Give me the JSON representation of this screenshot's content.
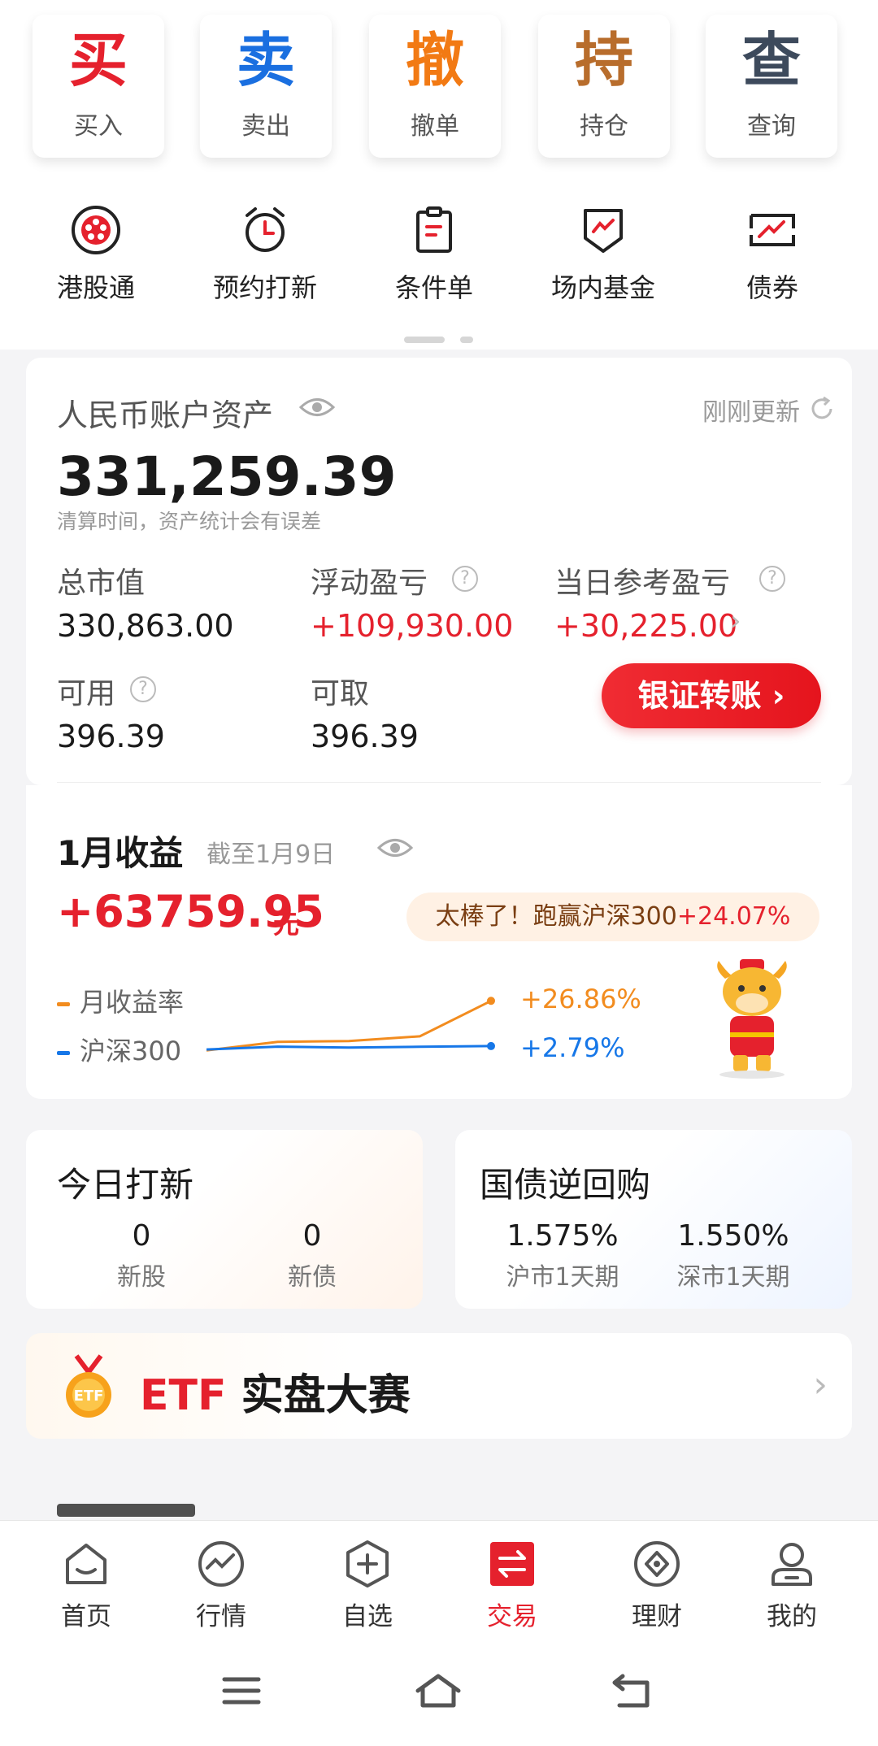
{
  "actions": [
    {
      "char": "买",
      "label": "买入",
      "color": "#e5212d"
    },
    {
      "char": "卖",
      "label": "卖出",
      "color": "#1a6fe0"
    },
    {
      "char": "撤",
      "label": "撤单",
      "color": "#f27a14"
    },
    {
      "char": "持",
      "label": "持仓",
      "color": "#b86d2c"
    },
    {
      "char": "查",
      "label": "查询",
      "color": "#3d4a5c"
    }
  ],
  "quick": [
    {
      "label": "港股通",
      "icon": "hk-bauhinia-icon"
    },
    {
      "label": "预约打新",
      "icon": "alarm-clock-icon"
    },
    {
      "label": "条件单",
      "icon": "clipboard-icon"
    },
    {
      "label": "场内基金",
      "icon": "fund-shield-icon"
    },
    {
      "label": "债券",
      "icon": "bond-chart-icon"
    }
  ],
  "asset": {
    "title": "人民币账户资产",
    "updated": "刚刚更新",
    "total": "331,259.39",
    "note": "清算时间，资产统计会有误差",
    "market_value_label": "总市值",
    "market_value": "330,863.00",
    "floating_pl_label": "浮动盈亏",
    "floating_pl": "+109,930.00",
    "daily_pl_label": "当日参考盈亏",
    "daily_pl": "+30,225.00",
    "available_label": "可用",
    "available": "396.39",
    "withdrawable_label": "可取",
    "withdrawable": "396.39",
    "transfer_button": "银证转账",
    "transfer_chevron": "›"
  },
  "income": {
    "title": "1月收益",
    "as_of": "截至1月9日",
    "amount": "+63759.95",
    "unit": "元",
    "bubble_text": "太棒了！跑赢沪深300",
    "bubble_value": "+24.07%",
    "legend_monthly": "月收益率",
    "legend_index": "沪深300",
    "monthly_pct": "+26.86%",
    "index_pct": "+2.79%"
  },
  "chart_data": {
    "type": "line",
    "x": [
      1,
      2,
      3,
      4,
      5
    ],
    "series": [
      {
        "name": "月收益率",
        "values": [
          0.5,
          5.0,
          5.5,
          8.0,
          26.86
        ],
        "color": "#f28c1f"
      },
      {
        "name": "沪深300",
        "values": [
          1.0,
          2.5,
          2.0,
          2.4,
          2.79
        ],
        "color": "#1677e8"
      }
    ],
    "ylim": [
      -2,
      30
    ]
  },
  "ipo": {
    "title": "今日打新",
    "stocks_count": "0",
    "stocks_label": "新股",
    "bonds_count": "0",
    "bonds_label": "新债"
  },
  "repo": {
    "title": "国债逆回购",
    "sh_rate": "1.575%",
    "sh_label": "沪市1天期",
    "sz_rate": "1.550%",
    "sz_label": "深市1天期"
  },
  "etf": {
    "en": "ETF",
    "cn": "实盘大赛",
    "chevron": "›"
  },
  "nav": [
    {
      "label": "首页",
      "icon": "home-icon"
    },
    {
      "label": "行情",
      "icon": "market-icon"
    },
    {
      "label": "自选",
      "icon": "watchlist-icon"
    },
    {
      "label": "交易",
      "icon": "trade-icon",
      "active": true
    },
    {
      "label": "理财",
      "icon": "wealth-icon"
    },
    {
      "label": "我的",
      "icon": "profile-icon"
    }
  ]
}
